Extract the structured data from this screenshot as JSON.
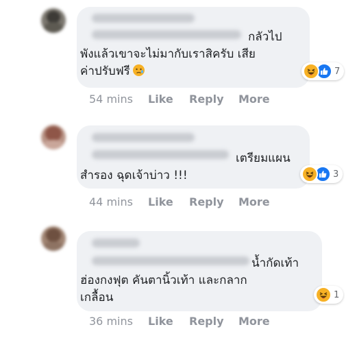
{
  "comments": [
    {
      "line1": "กลัวไป",
      "line2": "พังแล้วเขาจะไม่มากับเราสิครับ เสีย",
      "line3": "ค่าปรับฟรี",
      "emoji": "crying-face",
      "reaction_count": "7",
      "time": "54 mins",
      "like": "Like",
      "reply": "Reply",
      "more": "More"
    },
    {
      "line1": "เตรียมแผน",
      "line2": "สำรอง ฉุดเจ้าบ่าว !!!",
      "reaction_count": "3",
      "time": "44 mins",
      "like": "Like",
      "reply": "Reply",
      "more": "More"
    },
    {
      "line1": "น้ำกัดเท้า",
      "line2": "ฮ่องกงฟุต คันตานิ้วเท้า และกลาก",
      "line3": "เกลื้อน",
      "reaction_count": "1",
      "time": "36 mins",
      "like": "Like",
      "reply": "Reply",
      "more": "More"
    }
  ],
  "colors": {
    "bubble": "#eff1f4",
    "action": "#90949c",
    "like_blue": "#1877f2",
    "haha_yellow": "#f7b125"
  },
  "icons": [
    "haha-reaction-icon",
    "like-reaction-icon",
    "crying-face-emoji-icon"
  ]
}
